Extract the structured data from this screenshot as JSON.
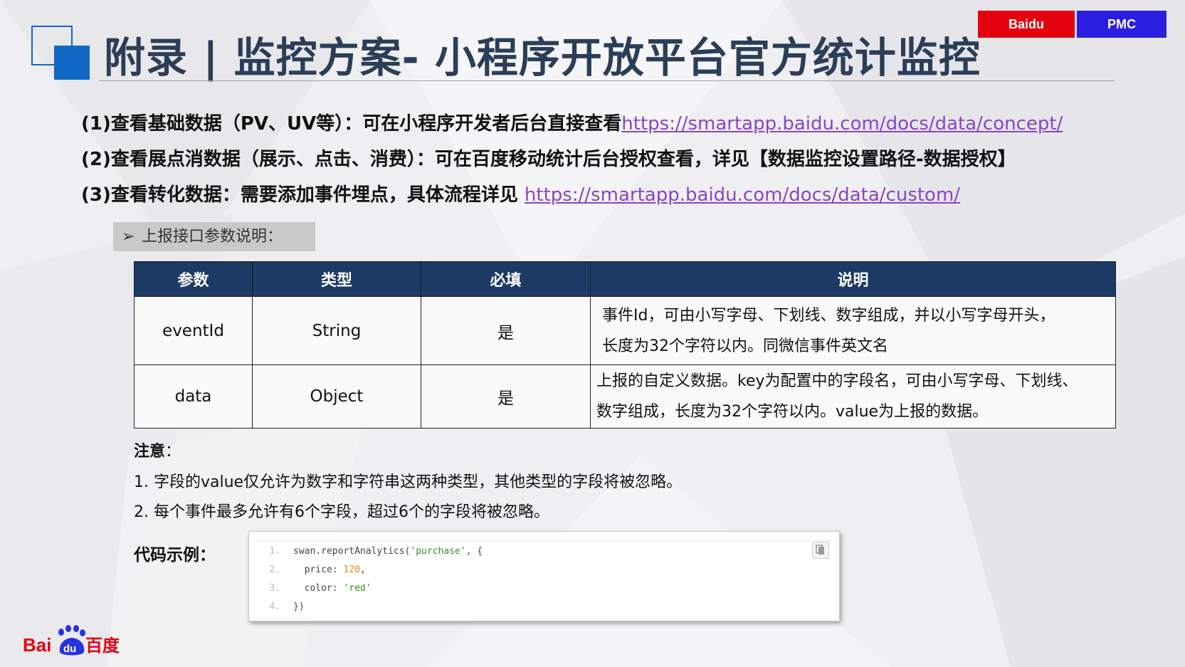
{
  "header": {
    "title": "附录 | 监控方案- 小程序开放平台官方统计监控",
    "tags": [
      "Baidu",
      "PMC"
    ]
  },
  "lines": [
    {
      "text": "(1)查看基础数据（PV、UV等）：可在小程序开发者后台直接查看",
      "link": "https://smartapp.baidu.com/docs/data/concept/"
    },
    {
      "text": "(2)查看展点消数据（展示、点击、消费）：可在百度移动统计后台授权查看，详见【数据监控设置路径-数据授权】",
      "link": ""
    },
    {
      "text": "(3)查看转化数据：需要添加事件埋点，具体流程详见 ",
      "link": "https://smartapp.baidu.com/docs/data/custom/"
    }
  ],
  "subhead": {
    "arrow": "➢",
    "label": "上报接口参数说明："
  },
  "table": {
    "headers": [
      "参数",
      "类型",
      "必填",
      "说明"
    ],
    "rows": [
      {
        "param": "eventId",
        "type": "String",
        "required": "是",
        "desc": [
          "事件Id，可由小写字母、下划线、数字组成，并以小写字母开头，",
          "长度为32个字符以内。同微信事件英文名"
        ]
      },
      {
        "param": "data",
        "type": "Object",
        "required": "是",
        "desc": [
          "上报的自定义数据。key为配置中的字段名，可由小写字母、下划线、",
          "数字组成，长度为32个字符以内。value为上报的数据。"
        ]
      }
    ]
  },
  "notes": {
    "title": "注意",
    "title_suffix": "：",
    "items": [
      "1. 字段的value仅允许为数字和字符串这两种类型，其他类型的字段将被忽略。",
      "2. 每个事件最多允许有6个字段，超过6个的字段将被忽略。"
    ]
  },
  "code": {
    "label": "代码示例：",
    "lines": [
      {
        "num": "1.",
        "pre": "swan.reportAnalytics(",
        "str": "'purchase'",
        "post": ", {"
      },
      {
        "num": "2.",
        "pre": "  price: ",
        "numval": "120",
        "post": ","
      },
      {
        "num": "3.",
        "pre": "  color: ",
        "str": "'red'",
        "post": ""
      },
      {
        "num": "4.",
        "pre": "})",
        "post": ""
      }
    ]
  },
  "footer_logo": {
    "text_left": "Bai",
    "text_paw": "du",
    "text_cn": "百度"
  },
  "colors": {
    "title": "#2b3e58",
    "table_header": "#1c3a63",
    "link": "#8a44c8",
    "baidu_red": "#e3000f",
    "pmc_blue": "#2a1ee0",
    "accent_blue": "#1168c4"
  }
}
